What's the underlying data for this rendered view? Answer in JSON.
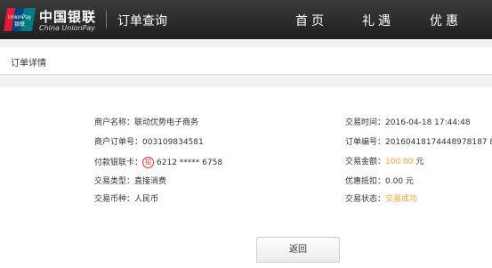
{
  "header": {
    "logo_text": "UnionPay 银联",
    "brand_cn": "中国银联",
    "brand_en": "China UnionPay",
    "page_title": "订单查询",
    "nav": [
      "首页",
      "礼遇",
      "优惠"
    ]
  },
  "section_title": "订单详情",
  "details": {
    "merchant_name_label": "商户名称：",
    "merchant_name": "联动优势电子商务",
    "merchant_order_label": "商户订单号：",
    "merchant_order": "003109834581",
    "card_label": "付款银联卡：",
    "card_badge": "招",
    "card_number": "6212 ***** 6758",
    "type_label": "交易类型：",
    "type_value": "直接消费",
    "currency_label": "交易币种：",
    "currency_value": "人民币",
    "time_label": "交易时间：",
    "time_value": "2016-04-18 17:44:48",
    "order_no_label": "订单编号：",
    "order_no_value": "20160418174448978187 8",
    "amount_label": "交易金额：",
    "amount_value": "100.00",
    "amount_unit": "元",
    "discount_label": "优惠抵扣：",
    "discount_value": "0.00 元",
    "status_label": "交易状态：",
    "status_value": "交易成功"
  },
  "back_button": "返回",
  "colors": {
    "accent": "#f29f2e",
    "topbar": "#262626"
  }
}
